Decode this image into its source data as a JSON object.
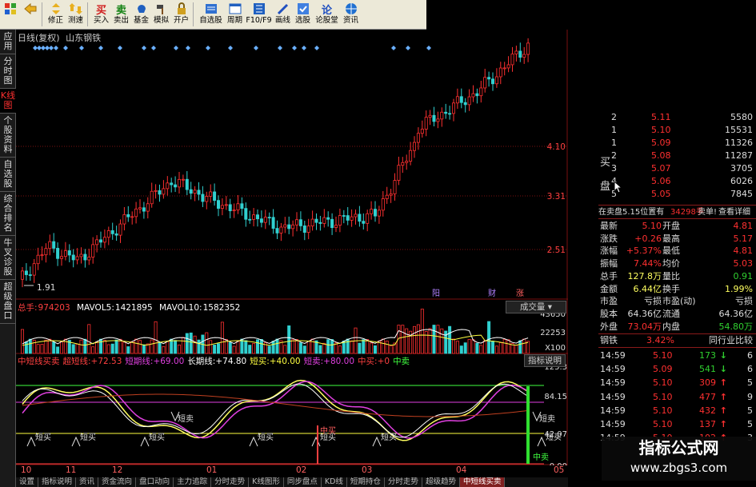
{
  "toolbar": [
    {
      "icon": "windows-logo-icon",
      "label": ""
    },
    {
      "icon": "back-arrow-icon",
      "label": ""
    },
    {
      "icon": "up-down-arrows-icon",
      "label": "修正"
    },
    {
      "icon": "test-arrows-icon",
      "label": "测速"
    },
    {
      "icon": "buy-icon",
      "glyph": "买",
      "color": "#d02020",
      "label": "买入"
    },
    {
      "icon": "sell-icon",
      "glyph": "卖",
      "color": "#108010",
      "label": "卖出"
    },
    {
      "icon": "fund-icon",
      "label": "基金"
    },
    {
      "icon": "simulate-icon",
      "label": "模拟"
    },
    {
      "icon": "lock-icon",
      "label": "开户"
    },
    {
      "icon": "favorites-icon",
      "label": "自选股"
    },
    {
      "icon": "period-icon",
      "label": "周期"
    },
    {
      "icon": "f10-icon",
      "label": "F10/F9"
    },
    {
      "icon": "draw-line-icon",
      "label": "画线"
    },
    {
      "icon": "select-stock-icon",
      "label": "选股"
    },
    {
      "icon": "forum-icon",
      "glyph": "论",
      "color": "#2050c0",
      "label": "论股堂"
    },
    {
      "icon": "news-icon",
      "label": "资讯"
    }
  ],
  "vtabs": [
    "应用",
    "分时图",
    "K线图",
    "个股资料",
    "自选股",
    "综合排名",
    "牛叉诊股",
    "超级盘口"
  ],
  "chart": {
    "title_mode": "日线(复权)",
    "title_stock": "山东钢铁",
    "price_labels": [
      "4.10",
      "3.31",
      "2.51"
    ],
    "low_label": "1.91",
    "markers": [
      "阳",
      "财",
      "涨"
    ]
  },
  "volume": {
    "total_label": "总手:",
    "total_value": "974203",
    "mavol5_label": "MAVOL5:",
    "mavol5_value": "1421895",
    "mavol10_label": "MAVOL10:",
    "mavol10_value": "1582352",
    "tab_label": "成交量",
    "axis_labels": [
      "43650",
      "22253",
      "X100"
    ]
  },
  "indicator": {
    "items": [
      {
        "text": "中短线买卖",
        "color": "#ff4040"
      },
      {
        "text": "超短线:+72.53",
        "color": "#ff4040"
      },
      {
        "text": "短期线:+69.00",
        "color": "#e040e0"
      },
      {
        "text": "长期线:+74.80",
        "color": "#ffffff"
      },
      {
        "text": "短买:+40.00",
        "color": "#ffff40"
      },
      {
        "text": "短卖:+80.00",
        "color": "#e040e0"
      },
      {
        "text": "中买:+0",
        "color": "#ff4040"
      },
      {
        "text": "中卖",
        "color": "#40ff40"
      }
    ],
    "tab_label": "指标说明",
    "axis_labels": [
      "125.3",
      "84.15",
      "42.07",
      "0.00"
    ],
    "annotations": [
      "短买",
      "中买",
      "短卖",
      "中卖"
    ]
  },
  "xaxis": [
    "10",
    "11",
    "12",
    "01",
    "02",
    "03",
    "04",
    "05"
  ],
  "bottom_tabs": [
    "设置",
    "指标说明",
    "资讯",
    "资金流向",
    "盘口动向",
    "主力追踪",
    "分时走势",
    "K线图形",
    "同步盘点",
    "KD线",
    "短期持仓",
    "分时走势",
    "超级趋势",
    "中短线买卖"
  ],
  "orderbook": {
    "side_labels": [
      "买",
      "盘"
    ],
    "rows": [
      {
        "lvl": "2",
        "price": "5.11",
        "vol": "5580"
      },
      {
        "lvl": "1",
        "price": "5.10",
        "vol": "15531"
      },
      {
        "lvl": "1",
        "price": "5.09",
        "vol": "11326"
      },
      {
        "lvl": "2",
        "price": "5.08",
        "vol": "11287"
      },
      {
        "lvl": "3",
        "price": "5.07",
        "vol": "3705"
      },
      {
        "lvl": "4",
        "price": "5.06",
        "vol": "6026"
      },
      {
        "lvl": "5",
        "price": "5.05",
        "vol": "7845"
      }
    ]
  },
  "position": {
    "text": "在卖盘5.15位置有",
    "vol": "34298手",
    "action": "卖单!",
    "link": "查看详细"
  },
  "quote": [
    {
      "l1": "最新",
      "v1": "5.10",
      "l2": "开盘",
      "v2": "4.81"
    },
    {
      "l1": "涨跌",
      "v1": "+0.26",
      "l2": "最高",
      "v2": "5.17"
    },
    {
      "l1": "涨幅",
      "v1": "+5.37%",
      "l2": "最低",
      "v2": "4.81"
    },
    {
      "l1": "振幅",
      "v1": "7.44%",
      "l2": "均价",
      "v2": "5.03"
    },
    {
      "l1": "总手",
      "v1": "127.8万",
      "l2": "量比",
      "v2": "0.91"
    },
    {
      "l1": "金额",
      "v1": "6.44亿",
      "l2": "换手",
      "v2": "1.99%"
    },
    {
      "l1": "市盈",
      "v1": "亏损",
      "l2": "市盈(动)",
      "v2": "亏损"
    },
    {
      "l1": "股本",
      "v1": "64.36亿",
      "l2": "流通",
      "v2": "64.36亿"
    },
    {
      "l1": "外盘",
      "v1": "73.04万",
      "l2": "内盘",
      "v2": "54.80万"
    }
  ],
  "sector": {
    "name": "钢铁",
    "pct": "3.42%",
    "compare": "同行业比较"
  },
  "ticks": [
    {
      "time": "14:59",
      "price": "5.10",
      "vol": "173",
      "dir": "down",
      "n": "6"
    },
    {
      "time": "14:59",
      "price": "5.09",
      "vol": "541",
      "dir": "down",
      "n": "6"
    },
    {
      "time": "14:59",
      "price": "5.10",
      "vol": "309",
      "dir": "up",
      "n": "5"
    },
    {
      "time": "14:59",
      "price": "5.10",
      "vol": "477",
      "dir": "up",
      "n": "9"
    },
    {
      "time": "14:59",
      "price": "5.10",
      "vol": "432",
      "dir": "up",
      "n": "5"
    },
    {
      "time": "14:59",
      "price": "5.10",
      "vol": "137",
      "dir": "up",
      "n": "5"
    },
    {
      "time": "14:59",
      "price": "5.10",
      "vol": "102",
      "dir": "up",
      "n": "3"
    }
  ],
  "watermark": {
    "line1": "指标公式网",
    "line2": "www.zbgs3.com"
  },
  "colors": {
    "up": "#ff3030",
    "down": "#30d0d0",
    "grid": "#7a1010",
    "panel_red": "#ff3030",
    "panel_green": "#30d030",
    "panel_yellow": "#ffff40"
  }
}
